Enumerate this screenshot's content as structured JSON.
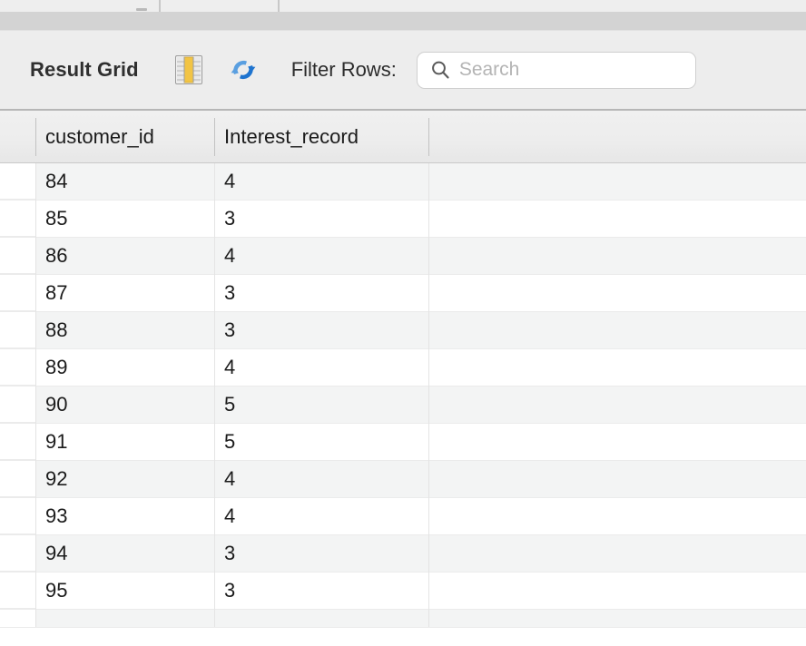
{
  "tabstrip": {
    "divider_positions": [
      175,
      306
    ],
    "glyph_name": "tab-overflow-glyph"
  },
  "toolbar": {
    "title": "Result Grid",
    "grid_icon_name": "result-grid-icon",
    "refresh_icon_name": "refresh-icon",
    "filter_label": "Filter Rows:",
    "search": {
      "value": "",
      "placeholder": "Search",
      "icon_name": "search-icon"
    }
  },
  "grid": {
    "columns": [
      "customer_id",
      "Interest_record",
      ""
    ],
    "column_x": [
      39,
      236,
      472
    ],
    "rows": [
      {
        "customer_id": "84",
        "Interest_record": "4",
        "extra": ""
      },
      {
        "customer_id": "85",
        "Interest_record": "3",
        "extra": ""
      },
      {
        "customer_id": "86",
        "Interest_record": "4",
        "extra": ""
      },
      {
        "customer_id": "87",
        "Interest_record": "3",
        "extra": ""
      },
      {
        "customer_id": "88",
        "Interest_record": "3",
        "extra": ""
      },
      {
        "customer_id": "89",
        "Interest_record": "4",
        "extra": ""
      },
      {
        "customer_id": "90",
        "Interest_record": "5",
        "extra": ""
      },
      {
        "customer_id": "91",
        "Interest_record": "5",
        "extra": ""
      },
      {
        "customer_id": "92",
        "Interest_record": "4",
        "extra": ""
      },
      {
        "customer_id": "93",
        "Interest_record": "4",
        "extra": ""
      },
      {
        "customer_id": "94",
        "Interest_record": "3",
        "extra": ""
      },
      {
        "customer_id": "95",
        "Interest_record": "3",
        "extra": ""
      },
      {
        "customer_id": "",
        "Interest_record": "",
        "extra": ""
      }
    ]
  },
  "colors": {
    "toolbar_bg": "#ededed",
    "band_bg": "#d3d3d3",
    "header_bg": "#ededed",
    "row_stripe": "#f3f4f4",
    "row_plain": "#ffffff",
    "text": "#1b1b1b",
    "placeholder": "#b4b4b4",
    "refresh_blue_light": "#4a90d9",
    "refresh_blue_dark": "#1f6fd0",
    "grid_icon_yellow": "#f2c444"
  }
}
